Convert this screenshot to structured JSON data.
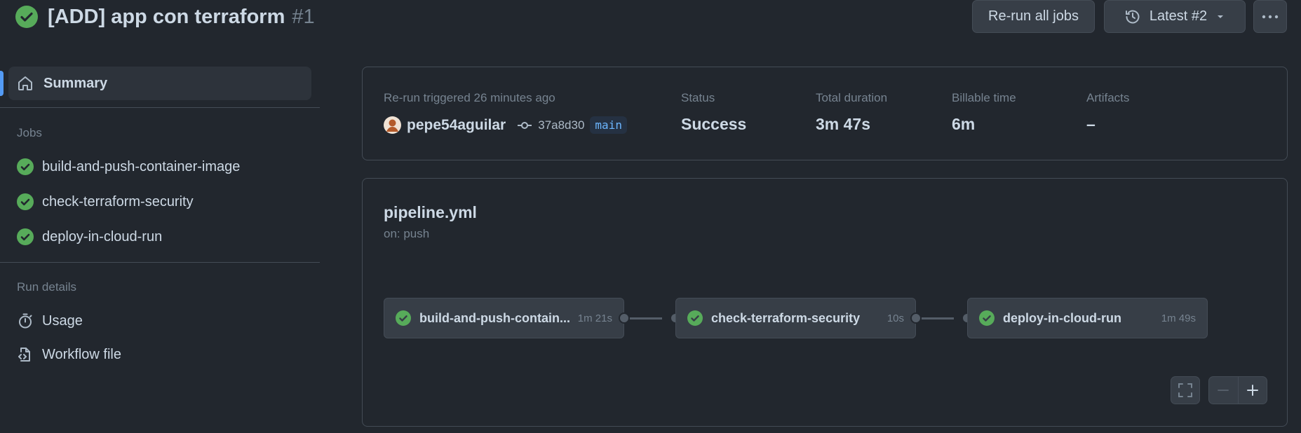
{
  "header": {
    "title": "[ADD] app con terraform",
    "run_number": "#1",
    "rerun_button": "Re-run all jobs",
    "attempt_button": "Latest #2",
    "more_icon": "kebab-horizontal-icon"
  },
  "sidebar": {
    "summary_label": "Summary",
    "jobs_heading": "Jobs",
    "jobs": [
      {
        "label": "build-and-push-container-image",
        "status": "success"
      },
      {
        "label": "check-terraform-security",
        "status": "success"
      },
      {
        "label": "deploy-in-cloud-run",
        "status": "success"
      }
    ],
    "run_details_heading": "Run details",
    "usage_label": "Usage",
    "workflow_file_label": "Workflow file"
  },
  "summary": {
    "trigger_text": "Re-run triggered 26 minutes ago",
    "actor": "pepe54aguilar",
    "commit": "37a8d30",
    "branch": "main",
    "status_label": "Status",
    "status_value": "Success",
    "duration_label": "Total duration",
    "duration_value": "3m 47s",
    "billable_label": "Billable time",
    "billable_value": "6m",
    "artifacts_label": "Artifacts",
    "artifacts_value": "–"
  },
  "workflow": {
    "file": "pipeline.yml",
    "trigger": "on: push",
    "jobs": [
      {
        "name": "build-and-push-contain...",
        "duration": "1m 21s"
      },
      {
        "name": "check-terraform-security",
        "duration": "10s"
      },
      {
        "name": "deploy-in-cloud-run",
        "duration": "1m 49s"
      }
    ]
  },
  "colors": {
    "success": "#57ab5a",
    "accent": "#539bf5",
    "background": "#22272e"
  }
}
